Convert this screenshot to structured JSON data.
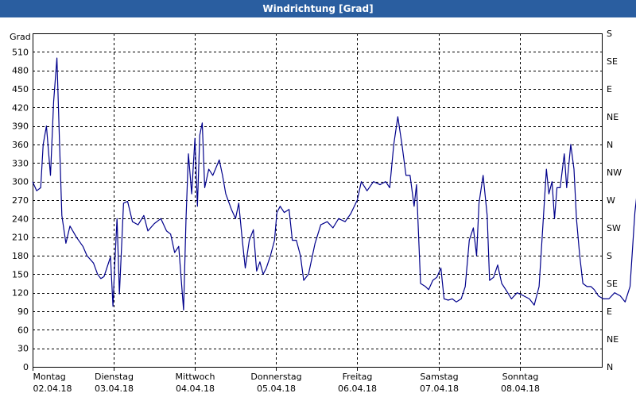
{
  "window": {
    "title": "Windrichtung [Grad]"
  },
  "chart_data": {
    "type": "line",
    "title": "Windrichtung [Grad]",
    "ylabel": "Grad",
    "ylim": [
      0,
      540
    ],
    "grid": true,
    "y_ticks": [
      0,
      30,
      60,
      90,
      120,
      150,
      180,
      210,
      240,
      270,
      300,
      330,
      360,
      390,
      420,
      450,
      480,
      510
    ],
    "right_ticks": [
      {
        "value": 0,
        "label": "N"
      },
      {
        "value": 45,
        "label": "NE"
      },
      {
        "value": 90,
        "label": "E"
      },
      {
        "value": 135,
        "label": "SE"
      },
      {
        "value": 180,
        "label": "S"
      },
      {
        "value": 225,
        "label": "SW"
      },
      {
        "value": 270,
        "label": "W"
      },
      {
        "value": 315,
        "label": "NW"
      },
      {
        "value": 360,
        "label": "N"
      },
      {
        "value": 405,
        "label": "NE"
      },
      {
        "value": 450,
        "label": "E"
      },
      {
        "value": 495,
        "label": "SE"
      },
      {
        "value": 540,
        "label": "S"
      }
    ],
    "x_range": [
      0,
      7
    ],
    "x_ticks": [
      {
        "day": "Montag",
        "date": "02.04.18"
      },
      {
        "day": "Dienstag",
        "date": "03.04.18"
      },
      {
        "day": "Mittwoch",
        "date": "04.04.18"
      },
      {
        "day": "Donnerstag",
        "date": "05.04.18"
      },
      {
        "day": "Freitag",
        "date": "06.04.18"
      },
      {
        "day": "Samstag",
        "date": "07.04.18"
      },
      {
        "day": "Sonntag",
        "date": "08.04.18"
      }
    ],
    "series": [
      {
        "color": "#00008b",
        "points": [
          [
            0.0,
            300
          ],
          [
            0.05,
            285
          ],
          [
            0.1,
            290
          ],
          [
            0.13,
            360
          ],
          [
            0.17,
            390
          ],
          [
            0.22,
            310
          ],
          [
            0.26,
            430
          ],
          [
            0.3,
            500
          ],
          [
            0.33,
            370
          ],
          [
            0.36,
            245
          ],
          [
            0.41,
            200
          ],
          [
            0.46,
            228
          ],
          [
            0.54,
            210
          ],
          [
            0.62,
            195
          ],
          [
            0.67,
            180
          ],
          [
            0.75,
            168
          ],
          [
            0.8,
            150
          ],
          [
            0.84,
            143
          ],
          [
            0.88,
            146
          ],
          [
            0.92,
            162
          ],
          [
            0.96,
            178
          ],
          [
            0.99,
            98
          ],
          [
            1.01,
            160
          ],
          [
            1.04,
            240
          ],
          [
            1.07,
            118
          ],
          [
            1.1,
            205
          ],
          [
            1.12,
            265
          ],
          [
            1.17,
            268
          ],
          [
            1.23,
            235
          ],
          [
            1.3,
            230
          ],
          [
            1.37,
            245
          ],
          [
            1.42,
            220
          ],
          [
            1.5,
            232
          ],
          [
            1.58,
            240
          ],
          [
            1.65,
            220
          ],
          [
            1.7,
            215
          ],
          [
            1.75,
            185
          ],
          [
            1.8,
            195
          ],
          [
            1.86,
            92
          ],
          [
            1.89,
            240
          ],
          [
            1.92,
            345
          ],
          [
            1.96,
            280
          ],
          [
            2.0,
            370
          ],
          [
            2.03,
            260
          ],
          [
            2.06,
            375
          ],
          [
            2.09,
            395
          ],
          [
            2.12,
            290
          ],
          [
            2.17,
            320
          ],
          [
            2.22,
            310
          ],
          [
            2.3,
            335
          ],
          [
            2.34,
            310
          ],
          [
            2.38,
            280
          ],
          [
            2.45,
            255
          ],
          [
            2.5,
            240
          ],
          [
            2.54,
            265
          ],
          [
            2.58,
            210
          ],
          [
            2.62,
            160
          ],
          [
            2.67,
            205
          ],
          [
            2.72,
            222
          ],
          [
            2.76,
            155
          ],
          [
            2.8,
            170
          ],
          [
            2.84,
            150
          ],
          [
            2.88,
            160
          ],
          [
            2.93,
            180
          ],
          [
            2.98,
            205
          ],
          [
            3.01,
            250
          ],
          [
            3.05,
            260
          ],
          [
            3.1,
            250
          ],
          [
            3.16,
            255
          ],
          [
            3.2,
            205
          ],
          [
            3.25,
            205
          ],
          [
            3.3,
            180
          ],
          [
            3.34,
            140
          ],
          [
            3.4,
            150
          ],
          [
            3.48,
            200
          ],
          [
            3.55,
            230
          ],
          [
            3.63,
            235
          ],
          [
            3.7,
            225
          ],
          [
            3.77,
            240
          ],
          [
            3.85,
            235
          ],
          [
            3.92,
            248
          ],
          [
            4.0,
            270
          ],
          [
            4.05,
            300
          ],
          [
            4.12,
            285
          ],
          [
            4.2,
            300
          ],
          [
            4.28,
            295
          ],
          [
            4.35,
            300
          ],
          [
            4.4,
            290
          ],
          [
            4.45,
            360
          ],
          [
            4.5,
            405
          ],
          [
            4.55,
            360
          ],
          [
            4.6,
            310
          ],
          [
            4.65,
            310
          ],
          [
            4.7,
            260
          ],
          [
            4.73,
            295
          ],
          [
            4.78,
            135
          ],
          [
            4.84,
            130
          ],
          [
            4.88,
            125
          ],
          [
            4.93,
            140
          ],
          [
            4.98,
            145
          ],
          [
            5.03,
            160
          ],
          [
            5.07,
            110
          ],
          [
            5.12,
            108
          ],
          [
            5.17,
            110
          ],
          [
            5.22,
            105
          ],
          [
            5.28,
            110
          ],
          [
            5.33,
            130
          ],
          [
            5.38,
            205
          ],
          [
            5.43,
            225
          ],
          [
            5.47,
            180
          ],
          [
            5.5,
            265
          ],
          [
            5.55,
            310
          ],
          [
            5.6,
            245
          ],
          [
            5.63,
            140
          ],
          [
            5.68,
            145
          ],
          [
            5.73,
            165
          ],
          [
            5.78,
            135
          ],
          [
            5.83,
            125
          ],
          [
            5.9,
            110
          ],
          [
            5.97,
            120
          ],
          [
            6.05,
            115
          ],
          [
            6.12,
            110
          ],
          [
            6.18,
            100
          ],
          [
            6.24,
            130
          ],
          [
            6.28,
            215
          ],
          [
            6.33,
            320
          ],
          [
            6.36,
            280
          ],
          [
            6.4,
            300
          ],
          [
            6.43,
            240
          ],
          [
            6.46,
            290
          ],
          [
            6.5,
            290
          ],
          [
            6.55,
            345
          ],
          [
            6.58,
            290
          ],
          [
            6.63,
            360
          ],
          [
            6.67,
            320
          ],
          [
            6.7,
            240
          ],
          [
            6.74,
            180
          ],
          [
            6.78,
            135
          ],
          [
            6.83,
            130
          ],
          [
            6.88,
            130
          ],
          [
            6.92,
            125
          ],
          [
            6.97,
            115
          ],
          [
            7.03,
            110
          ],
          [
            7.1,
            110
          ],
          [
            7.17,
            120
          ],
          [
            7.24,
            115
          ],
          [
            7.3,
            105
          ],
          [
            7.36,
            130
          ],
          [
            7.42,
            250
          ],
          [
            7.45,
            285
          ],
          [
            7.49,
            290
          ],
          [
            7.53,
            300
          ]
        ]
      }
    ]
  }
}
